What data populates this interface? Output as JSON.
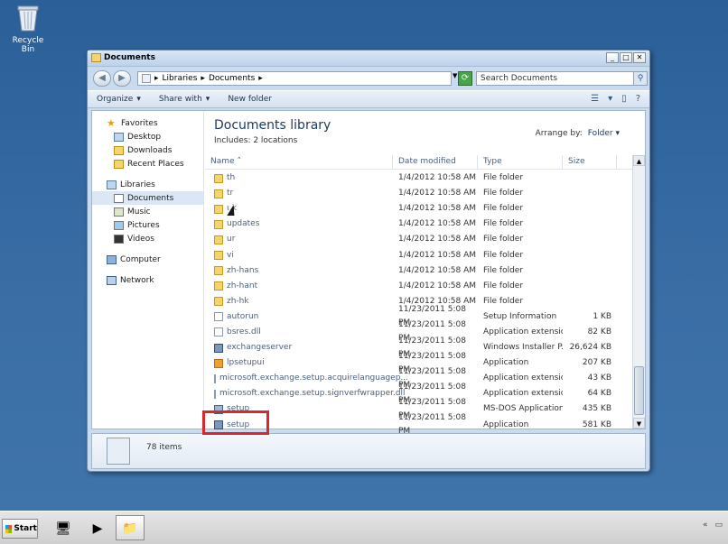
{
  "desktop": {
    "recycle_bin_label": "Recycle Bin"
  },
  "window": {
    "title": "Documents",
    "controls": {
      "minimize": "_",
      "maximize": "□",
      "close": "✕"
    }
  },
  "address": {
    "back": "◀",
    "forward": "▶",
    "breadcrumb": [
      "Libraries",
      "Documents"
    ],
    "separator": "▸",
    "search_placeholder": "Search Documents"
  },
  "toolbar": {
    "organize": "Organize",
    "share_with": "Share with",
    "new_folder": "New folder"
  },
  "nav": {
    "favorites": "Favorites",
    "desktop": "Desktop",
    "downloads": "Downloads",
    "recent_places": "Recent Places",
    "libraries": "Libraries",
    "documents": "Documents",
    "music": "Music",
    "pictures": "Pictures",
    "videos": "Videos",
    "computer": "Computer",
    "network": "Network"
  },
  "library": {
    "title": "Documents library",
    "includes": "Includes: 2 locations",
    "arrange_by_label": "Arrange by:",
    "arrange_by_value": "Folder"
  },
  "columns": {
    "name": "Name",
    "date": "Date modified",
    "type": "Type",
    "size": "Size"
  },
  "files": [
    {
      "name": "th",
      "date": "1/4/2012 10:58 AM",
      "type": "File folder",
      "size": "",
      "icon": "folder"
    },
    {
      "name": "tr",
      "date": "1/4/2012 10:58 AM",
      "type": "File folder",
      "size": "",
      "icon": "folder"
    },
    {
      "name": "uk",
      "date": "1/4/2012 10:58 AM",
      "type": "File folder",
      "size": "",
      "icon": "folder"
    },
    {
      "name": "updates",
      "date": "1/4/2012 10:58 AM",
      "type": "File folder",
      "size": "",
      "icon": "folder"
    },
    {
      "name": "ur",
      "date": "1/4/2012 10:58 AM",
      "type": "File folder",
      "size": "",
      "icon": "folder"
    },
    {
      "name": "vi",
      "date": "1/4/2012 10:58 AM",
      "type": "File folder",
      "size": "",
      "icon": "folder"
    },
    {
      "name": "zh-hans",
      "date": "1/4/2012 10:58 AM",
      "type": "File folder",
      "size": "",
      "icon": "folder"
    },
    {
      "name": "zh-hant",
      "date": "1/4/2012 10:58 AM",
      "type": "File folder",
      "size": "",
      "icon": "folder"
    },
    {
      "name": "zh-hk",
      "date": "1/4/2012 10:58 AM",
      "type": "File folder",
      "size": "",
      "icon": "folder"
    },
    {
      "name": "autorun",
      "date": "11/23/2011 5:08 PM",
      "type": "Setup Information",
      "size": "1 KB",
      "icon": "file"
    },
    {
      "name": "bsres.dll",
      "date": "11/23/2011 5:08 PM",
      "type": "Application extension",
      "size": "82 KB",
      "icon": "file"
    },
    {
      "name": "exchangeserver",
      "date": "11/23/2011 5:08 PM",
      "type": "Windows Installer P...",
      "size": "26,624 KB",
      "icon": "msi"
    },
    {
      "name": "lpsetupui",
      "date": "11/23/2011 5:08 PM",
      "type": "Application",
      "size": "207 KB",
      "icon": "lpsetup"
    },
    {
      "name": "microsoft.exchange.setup.acquirelanguagep...",
      "date": "11/23/2011 5:08 PM",
      "type": "Application extension",
      "size": "43 KB",
      "icon": "file"
    },
    {
      "name": "microsoft.exchange.setup.signverfwrapper.dll",
      "date": "11/23/2011 5:08 PM",
      "type": "Application extension",
      "size": "64 KB",
      "icon": "file"
    },
    {
      "name": "setup",
      "date": "11/23/2011 5:08 PM",
      "type": "MS-DOS Application",
      "size": "435 KB",
      "icon": "app"
    },
    {
      "name": "setup",
      "date": "11/23/2011 5:08 PM",
      "type": "Application",
      "size": "581 KB",
      "icon": "msi"
    }
  ],
  "status": {
    "item_count": "78 items"
  },
  "taskbar": {
    "start": "Start"
  },
  "colors": {
    "desktop": "#3a6ea5",
    "highlight_box": "#d9272e"
  }
}
